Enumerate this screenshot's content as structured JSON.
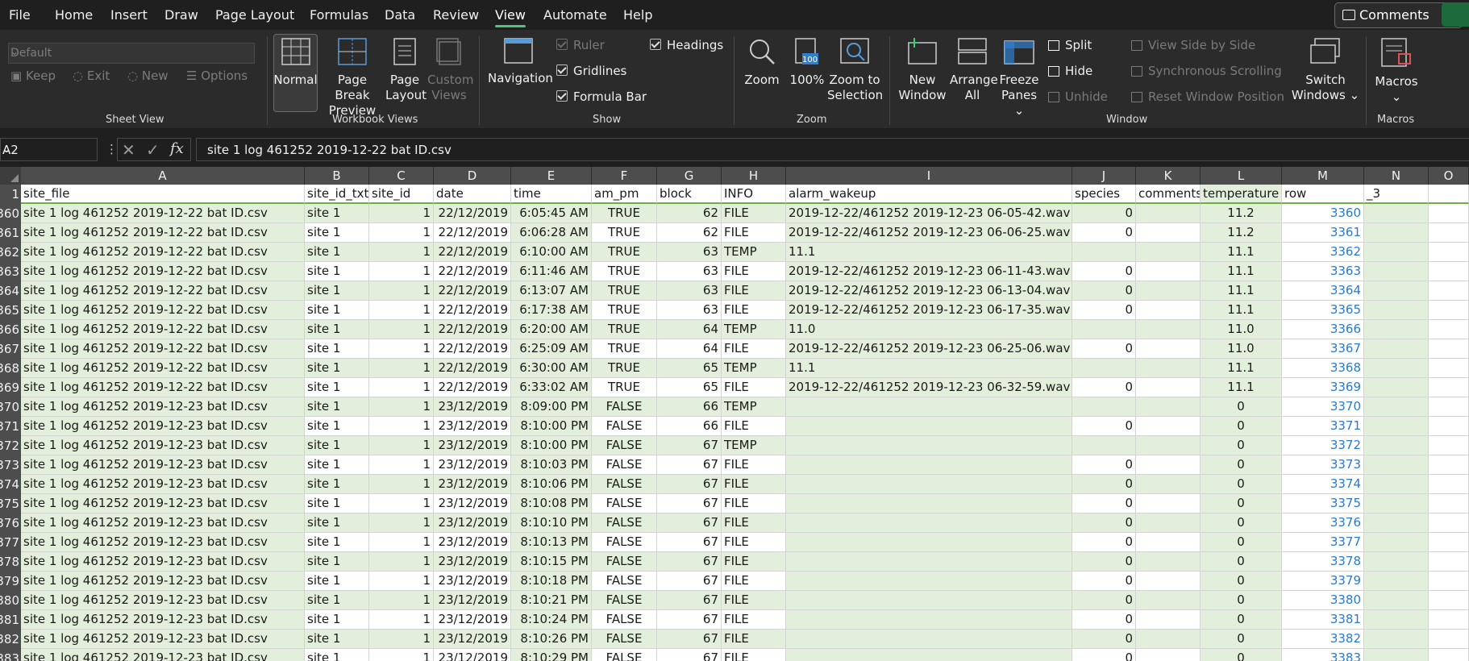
{
  "menu": {
    "items": [
      "File",
      "Home",
      "Insert",
      "Draw",
      "Page Layout",
      "Formulas",
      "Data",
      "Review",
      "View",
      "Automate",
      "Help"
    ],
    "active": "View",
    "comments_label": "Comments"
  },
  "ribbon": {
    "sheet_view": {
      "select_value": "Default",
      "keep": "Keep",
      "exit": "Exit",
      "new": "New",
      "options": "Options",
      "title": "Sheet View"
    },
    "workbook_views": {
      "normal": "Normal",
      "page_break_1": "Page Break",
      "page_break_2": "Preview",
      "page_layout_1": "Page",
      "page_layout_2": "Layout",
      "custom_1": "Custom",
      "custom_2": "Views",
      "title": "Workbook Views"
    },
    "show": {
      "navigation": "Navigation",
      "ruler": "Ruler",
      "gridlines": "Gridlines",
      "formula_bar": "Formula Bar",
      "headings": "Headings",
      "title": "Show"
    },
    "zoom": {
      "zoom": "Zoom",
      "hundred": "100%",
      "zoom_sel_1": "Zoom to",
      "zoom_sel_2": "Selection",
      "badge": "100",
      "title": "Zoom"
    },
    "window": {
      "new_1": "New",
      "new_2": "Window",
      "arrange_1": "Arrange",
      "arrange_2": "All",
      "freeze_1": "Freeze",
      "freeze_2": "Panes",
      "split": "Split",
      "hide": "Hide",
      "unhide": "Unhide",
      "side_by_side": "View Side by Side",
      "sync_scroll": "Synchronous Scrolling",
      "reset_pos": "Reset Window Position",
      "switch_1": "Switch",
      "switch_2": "Windows",
      "title": "Window"
    },
    "macros": {
      "label": "Macros",
      "title": "Macros"
    }
  },
  "formula_bar": {
    "name_box": "A2",
    "formula": "site 1 log 461252 2019-12-22 bat ID.csv"
  },
  "columns": [
    "A",
    "B",
    "C",
    "D",
    "E",
    "F",
    "G",
    "H",
    "I",
    "J",
    "K",
    "L",
    "M",
    "N",
    "O"
  ],
  "header_row": {
    "num": "1",
    "cells": [
      "site_file",
      "site_id_txt",
      "site_id",
      "date",
      "time",
      "am_pm",
      "block",
      "INFO",
      "alarm_wakeup",
      "species",
      "comments",
      "temperature",
      "row",
      "_3",
      ""
    ]
  },
  "rows": [
    {
      "num": "3360",
      "cells": [
        "site 1 log 461252 2019-12-22 bat ID.csv",
        "site 1",
        "1",
        "22/12/2019",
        "6:05:45 AM",
        "TRUE",
        "62",
        "FILE",
        "2019-12-22/461252 2019-12-23 06-05-42.wav",
        "0",
        "",
        "11.2",
        "3360",
        "",
        ""
      ]
    },
    {
      "num": "3361",
      "cells": [
        "site 1 log 461252 2019-12-22 bat ID.csv",
        "site 1",
        "1",
        "22/12/2019",
        "6:06:28 AM",
        "TRUE",
        "62",
        "FILE",
        "2019-12-22/461252 2019-12-23 06-06-25.wav",
        "0",
        "",
        "11.2",
        "3361",
        "",
        ""
      ]
    },
    {
      "num": "3362",
      "cells": [
        "site 1 log 461252 2019-12-22 bat ID.csv",
        "site 1",
        "1",
        "22/12/2019",
        "6:10:00 AM",
        "TRUE",
        "63",
        "TEMP",
        "11.1",
        "",
        "",
        "11.1",
        "3362",
        "",
        ""
      ]
    },
    {
      "num": "3363",
      "cells": [
        "site 1 log 461252 2019-12-22 bat ID.csv",
        "site 1",
        "1",
        "22/12/2019",
        "6:11:46 AM",
        "TRUE",
        "63",
        "FILE",
        "2019-12-22/461252 2019-12-23 06-11-43.wav",
        "0",
        "",
        "11.1",
        "3363",
        "",
        ""
      ]
    },
    {
      "num": "3364",
      "cells": [
        "site 1 log 461252 2019-12-22 bat ID.csv",
        "site 1",
        "1",
        "22/12/2019",
        "6:13:07 AM",
        "TRUE",
        "63",
        "FILE",
        "2019-12-22/461252 2019-12-23 06-13-04.wav",
        "0",
        "",
        "11.1",
        "3364",
        "",
        ""
      ]
    },
    {
      "num": "3365",
      "cells": [
        "site 1 log 461252 2019-12-22 bat ID.csv",
        "site 1",
        "1",
        "22/12/2019",
        "6:17:38 AM",
        "TRUE",
        "63",
        "FILE",
        "2019-12-22/461252 2019-12-23 06-17-35.wav",
        "0",
        "",
        "11.1",
        "3365",
        "",
        ""
      ]
    },
    {
      "num": "3366",
      "cells": [
        "site 1 log 461252 2019-12-22 bat ID.csv",
        "site 1",
        "1",
        "22/12/2019",
        "6:20:00 AM",
        "TRUE",
        "64",
        "TEMP",
        "11.0",
        "",
        "",
        "11.0",
        "3366",
        "",
        ""
      ]
    },
    {
      "num": "3367",
      "cells": [
        "site 1 log 461252 2019-12-22 bat ID.csv",
        "site 1",
        "1",
        "22/12/2019",
        "6:25:09 AM",
        "TRUE",
        "64",
        "FILE",
        "2019-12-22/461252 2019-12-23 06-25-06.wav",
        "0",
        "",
        "11.0",
        "3367",
        "",
        ""
      ]
    },
    {
      "num": "3368",
      "cells": [
        "site 1 log 461252 2019-12-22 bat ID.csv",
        "site 1",
        "1",
        "22/12/2019",
        "6:30:00 AM",
        "TRUE",
        "65",
        "TEMP",
        "11.1",
        "",
        "",
        "11.1",
        "3368",
        "",
        ""
      ]
    },
    {
      "num": "3369",
      "cells": [
        "site 1 log 461252 2019-12-22 bat ID.csv",
        "site 1",
        "1",
        "22/12/2019",
        "6:33:02 AM",
        "TRUE",
        "65",
        "FILE",
        "2019-12-22/461252 2019-12-23 06-32-59.wav",
        "0",
        "",
        "11.1",
        "3369",
        "",
        ""
      ]
    },
    {
      "num": "3370",
      "cells": [
        "site 1 log 461252 2019-12-23 bat ID.csv",
        "site 1",
        "1",
        "23/12/2019",
        "8:09:00 PM",
        "FALSE",
        "66",
        "TEMP",
        "",
        "",
        "",
        "0",
        "3370",
        "",
        ""
      ]
    },
    {
      "num": "3371",
      "cells": [
        "site 1 log 461252 2019-12-23 bat ID.csv",
        "site 1",
        "1",
        "23/12/2019",
        "8:10:00 PM",
        "FALSE",
        "66",
        "FILE",
        "",
        "0",
        "",
        "0",
        "3371",
        "",
        ""
      ]
    },
    {
      "num": "3372",
      "cells": [
        "site 1 log 461252 2019-12-23 bat ID.csv",
        "site 1",
        "1",
        "23/12/2019",
        "8:10:00 PM",
        "FALSE",
        "67",
        "TEMP",
        "",
        "",
        "",
        "0",
        "3372",
        "",
        ""
      ]
    },
    {
      "num": "3373",
      "cells": [
        "site 1 log 461252 2019-12-23 bat ID.csv",
        "site 1",
        "1",
        "23/12/2019",
        "8:10:03 PM",
        "FALSE",
        "67",
        "FILE",
        "",
        "0",
        "",
        "0",
        "3373",
        "",
        ""
      ]
    },
    {
      "num": "3374",
      "cells": [
        "site 1 log 461252 2019-12-23 bat ID.csv",
        "site 1",
        "1",
        "23/12/2019",
        "8:10:06 PM",
        "FALSE",
        "67",
        "FILE",
        "",
        "0",
        "",
        "0",
        "3374",
        "",
        ""
      ]
    },
    {
      "num": "3375",
      "cells": [
        "site 1 log 461252 2019-12-23 bat ID.csv",
        "site 1",
        "1",
        "23/12/2019",
        "8:10:08 PM",
        "FALSE",
        "67",
        "FILE",
        "",
        "0",
        "",
        "0",
        "3375",
        "",
        ""
      ]
    },
    {
      "num": "3376",
      "cells": [
        "site 1 log 461252 2019-12-23 bat ID.csv",
        "site 1",
        "1",
        "23/12/2019",
        "8:10:10 PM",
        "FALSE",
        "67",
        "FILE",
        "",
        "0",
        "",
        "0",
        "3376",
        "",
        ""
      ]
    },
    {
      "num": "3377",
      "cells": [
        "site 1 log 461252 2019-12-23 bat ID.csv",
        "site 1",
        "1",
        "23/12/2019",
        "8:10:13 PM",
        "FALSE",
        "67",
        "FILE",
        "",
        "0",
        "",
        "0",
        "3377",
        "",
        ""
      ]
    },
    {
      "num": "3378",
      "cells": [
        "site 1 log 461252 2019-12-23 bat ID.csv",
        "site 1",
        "1",
        "23/12/2019",
        "8:10:15 PM",
        "FALSE",
        "67",
        "FILE",
        "",
        "0",
        "",
        "0",
        "3378",
        "",
        ""
      ]
    },
    {
      "num": "3379",
      "cells": [
        "site 1 log 461252 2019-12-23 bat ID.csv",
        "site 1",
        "1",
        "23/12/2019",
        "8:10:18 PM",
        "FALSE",
        "67",
        "FILE",
        "",
        "0",
        "",
        "0",
        "3379",
        "",
        ""
      ]
    },
    {
      "num": "3380",
      "cells": [
        "site 1 log 461252 2019-12-23 bat ID.csv",
        "site 1",
        "1",
        "23/12/2019",
        "8:10:21 PM",
        "FALSE",
        "67",
        "FILE",
        "",
        "0",
        "",
        "0",
        "3380",
        "",
        ""
      ]
    },
    {
      "num": "3381",
      "cells": [
        "site 1 log 461252 2019-12-23 bat ID.csv",
        "site 1",
        "1",
        "23/12/2019",
        "8:10:24 PM",
        "FALSE",
        "67",
        "FILE",
        "",
        "0",
        "",
        "0",
        "3381",
        "",
        ""
      ]
    },
    {
      "num": "3382",
      "cells": [
        "site 1 log 461252 2019-12-23 bat ID.csv",
        "site 1",
        "1",
        "23/12/2019",
        "8:10:26 PM",
        "FALSE",
        "67",
        "FILE",
        "",
        "0",
        "",
        "0",
        "3382",
        "",
        ""
      ]
    },
    {
      "num": "3383",
      "cells": [
        "site 1 log 461252 2019-12-23 bat ID.csv",
        "site 1",
        "1",
        "23/12/2019",
        "8:10:29 PM",
        "FALSE",
        "67",
        "FILE",
        "",
        "0",
        "",
        "0",
        "3383",
        "",
        ""
      ]
    }
  ],
  "colors": {
    "accent": "#4ec27f",
    "band": "#e2efda",
    "row_link": "#2b79c7"
  }
}
